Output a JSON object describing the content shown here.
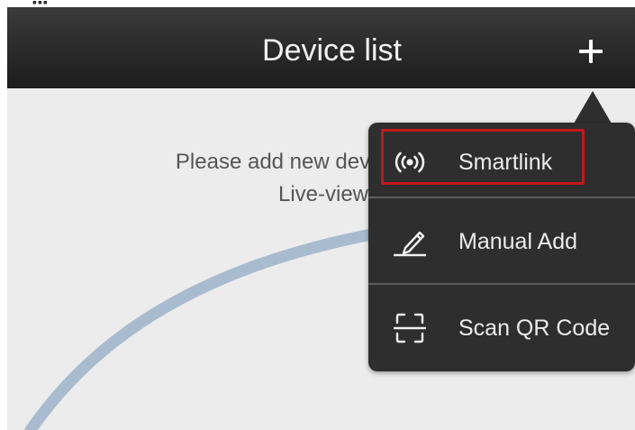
{
  "status_bar": {
    "fragment": "▪▪▪"
  },
  "nav": {
    "title": "Device list",
    "add_icon": "plus-icon"
  },
  "content": {
    "empty_hint_line1": "Please add new dev",
    "empty_hint_line2": "Live-view"
  },
  "menu": {
    "items": [
      {
        "label": "Smartlink",
        "icon": "wireless-signal-icon",
        "highlighted": true
      },
      {
        "label": "Manual Add",
        "icon": "pencil-icon"
      },
      {
        "label": "Scan QR Code",
        "icon": "qr-scan-icon"
      }
    ]
  },
  "colors": {
    "nav_background": "#262626",
    "popup_background": "#2e2e2e",
    "content_background": "#ececec",
    "highlight_border": "#c4161c",
    "arc_stroke": "#a9bccf"
  }
}
